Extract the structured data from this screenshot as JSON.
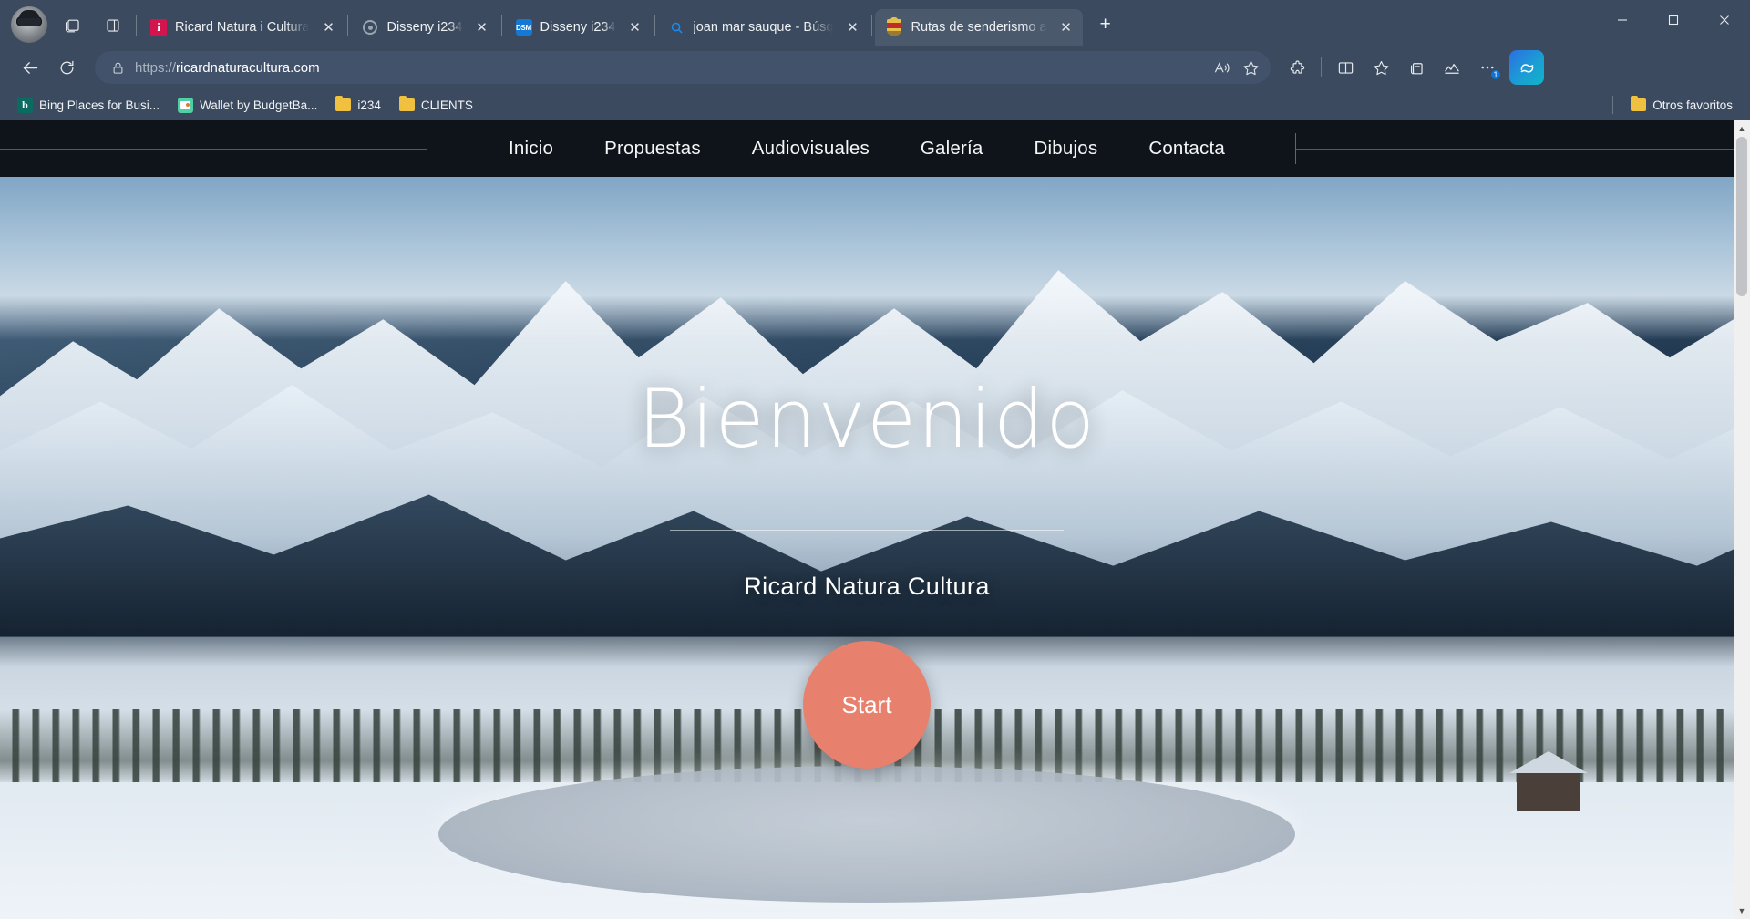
{
  "window": {
    "minimize_label": "—",
    "maximize_label": "❐",
    "close_label": "✕"
  },
  "tabbar": {
    "profile_name": "profile-avatar",
    "tab_search_label": "tab-search",
    "split_screen_label": "split-screen",
    "new_tab_label": "+",
    "close_glyph": "✕",
    "tabs": [
      {
        "title": "Ricard Natura i Cultura",
        "icon": "info-favicon",
        "active": false
      },
      {
        "title": "Disseny i234",
        "icon": "circle-dot-favicon",
        "active": false
      },
      {
        "title": "Disseny i234",
        "icon": "dsm-favicon",
        "active": false
      },
      {
        "title": "joan mar sauque - Búsq",
        "icon": "search-favicon",
        "active": false
      },
      {
        "title": "Rutas de senderismo a",
        "icon": "crest-favicon",
        "active": true
      }
    ]
  },
  "navbar": {
    "back_label": "back",
    "refresh_label": "refresh",
    "url_scheme": "https://",
    "url_host": "ricardnaturacultura.com",
    "full_url": "https://ricardnaturacultura.com",
    "lock_label": "site-lock",
    "read_aloud_label": "read-aloud",
    "favorite_label": "add-favorite",
    "extensions_label": "extensions",
    "split_label": "split-screen",
    "collections_label": "collections",
    "browser_essentials_label": "browser-essentials",
    "settings_more_label": "···",
    "settings_badge": "1",
    "copilot_label": "copilot"
  },
  "bookmarks": {
    "items": [
      {
        "label": "Bing Places for Busi...",
        "icon": "bing-icon"
      },
      {
        "label": "Wallet by BudgetBa...",
        "icon": "wallet-icon"
      },
      {
        "label": "i234",
        "icon": "folder-icon"
      },
      {
        "label": "CLIENTS",
        "icon": "folder-icon"
      }
    ],
    "other_favorites": "Otros favoritos",
    "other_favorites_icon": "folder-icon"
  },
  "site": {
    "nav": [
      {
        "label": "Inicio"
      },
      {
        "label": "Propuestas"
      },
      {
        "label": "Audiovisuales"
      },
      {
        "label": "Galería"
      },
      {
        "label": "Dibujos"
      },
      {
        "label": "Contacta"
      }
    ],
    "hero": {
      "title": "Bienvenido",
      "subtitle": "Ricard Natura Cultura",
      "cta_label": "Start",
      "cta_color": "#e8806e",
      "background_alt": "snowy-mountain-panorama-with-frozen-lake"
    }
  },
  "scrollbar": {
    "up_glyph": "▲",
    "down_glyph": "▼"
  }
}
